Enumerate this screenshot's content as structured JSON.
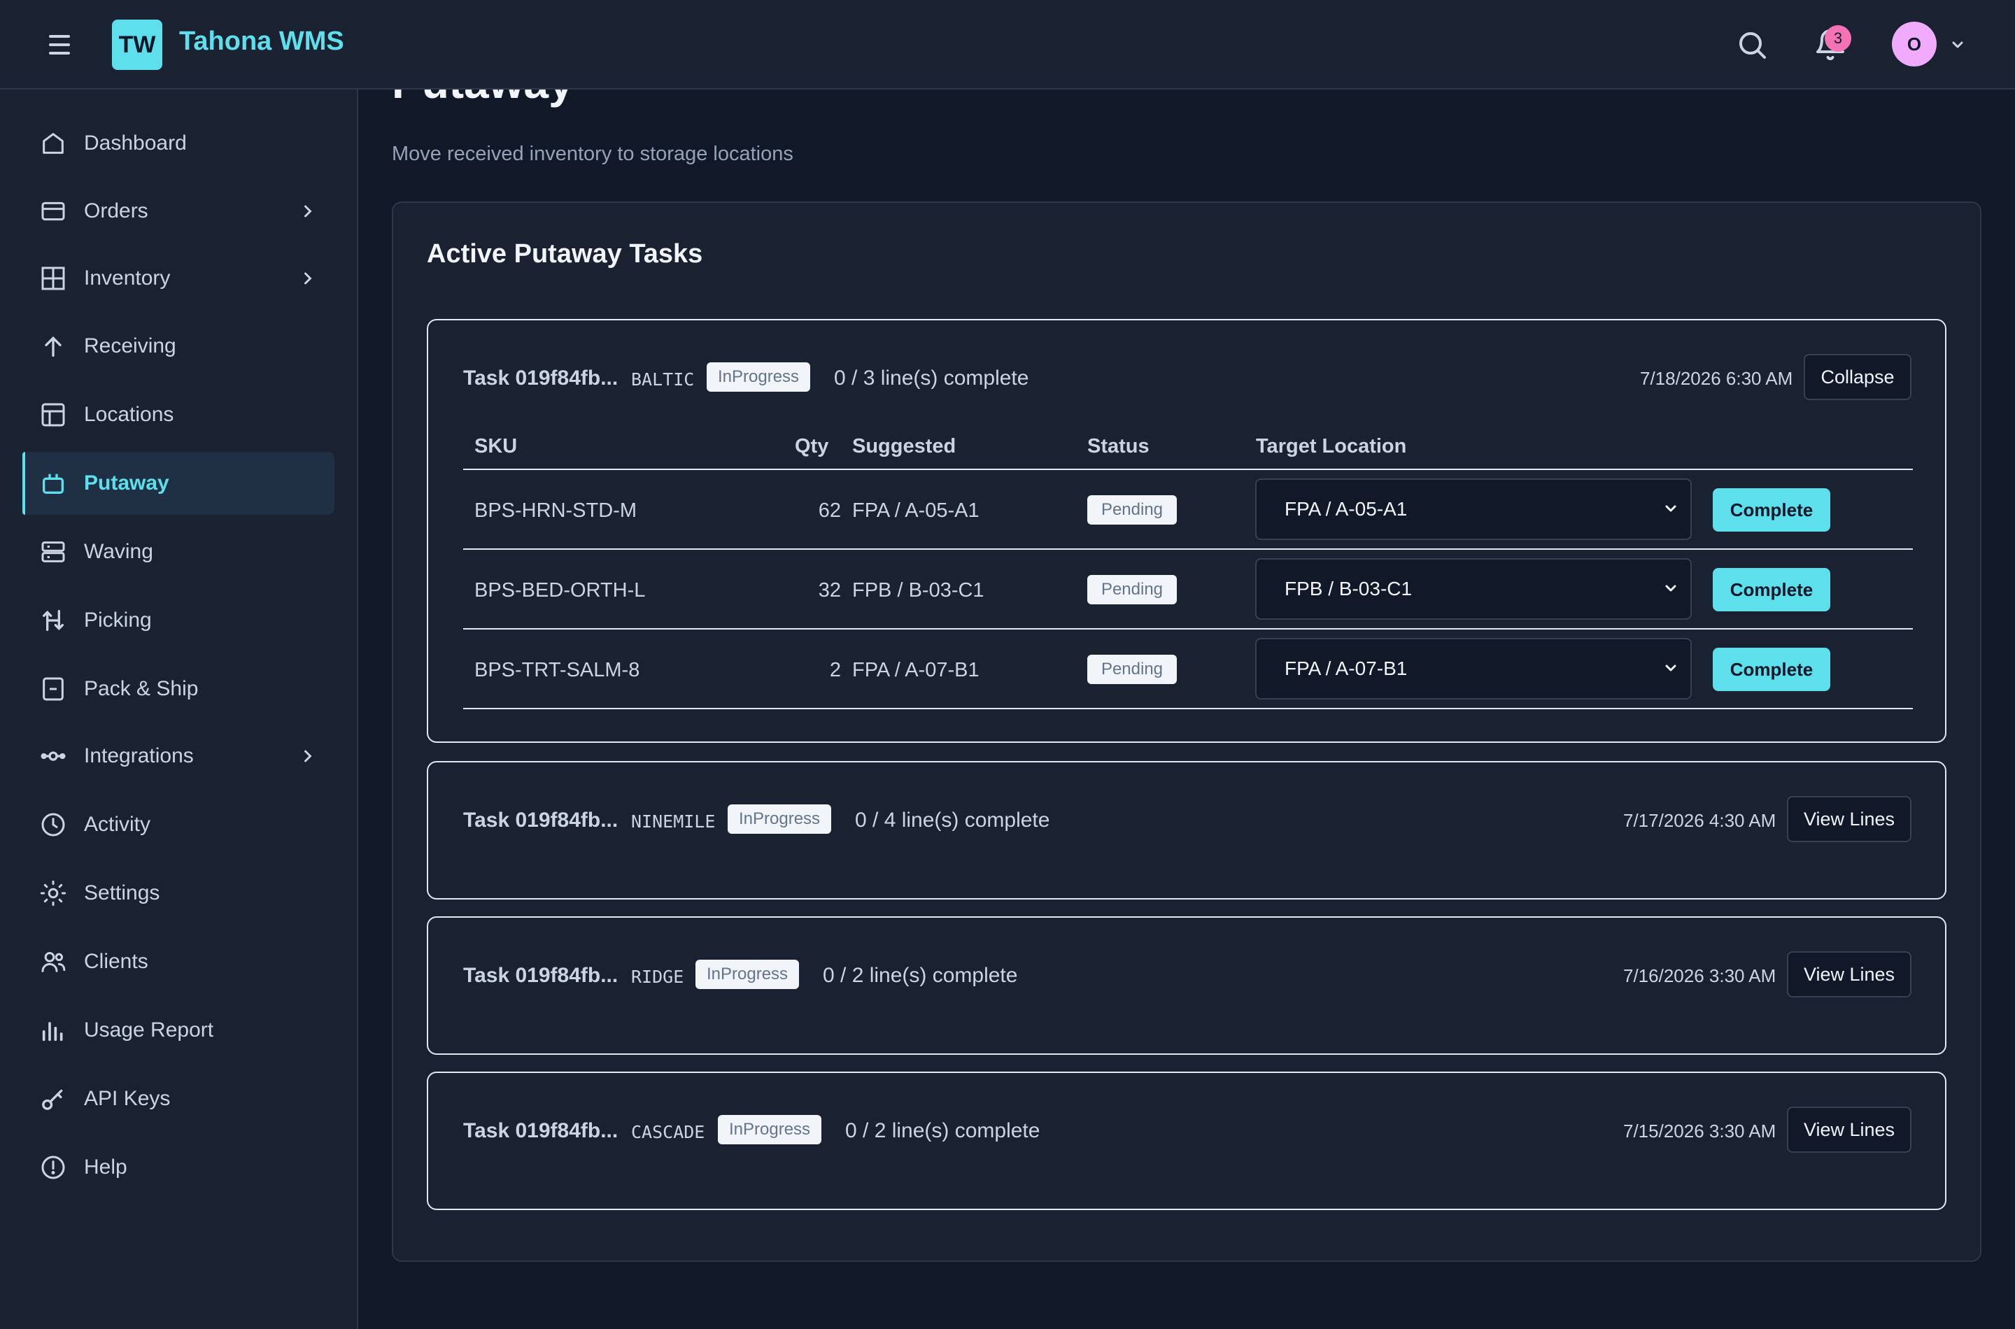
{
  "app": {
    "logo_text": "TW",
    "title": "Tahona WMS",
    "notification_count": "3",
    "avatar_initial": "O",
    "accent_color": "#5ee0ec"
  },
  "sidebar": {
    "items": [
      {
        "label": "Dashboard",
        "icon": "home-icon"
      },
      {
        "label": "Orders",
        "icon": "card-icon",
        "has_submenu": true
      },
      {
        "label": "Inventory",
        "icon": "grid-icon",
        "has_submenu": true
      },
      {
        "label": "Receiving",
        "icon": "arrow-up-icon"
      },
      {
        "label": "Locations",
        "icon": "table-icon"
      },
      {
        "label": "Putaway",
        "icon": "tray-icon",
        "active": true
      },
      {
        "label": "Waving",
        "icon": "server-icon"
      },
      {
        "label": "Picking",
        "icon": "arrows-icon"
      },
      {
        "label": "Pack & Ship",
        "icon": "box-icon"
      },
      {
        "label": "Integrations",
        "icon": "plug-icon",
        "has_submenu": true
      },
      {
        "label": "Activity",
        "icon": "clock-icon"
      },
      {
        "label": "Settings",
        "icon": "sun-gear-icon"
      },
      {
        "label": "Clients",
        "icon": "users-icon"
      },
      {
        "label": "Usage Report",
        "icon": "bar-chart-icon"
      },
      {
        "label": "API Keys",
        "icon": "key-icon"
      },
      {
        "label": "Help",
        "icon": "help-circle-icon"
      }
    ]
  },
  "page": {
    "title": "Putaway",
    "subtitle": "Move received inventory to storage locations",
    "card_title": "Active Putaway Tasks"
  },
  "table_headers": {
    "sku": "SKU",
    "qty": "Qty",
    "suggested": "Suggested",
    "status": "Status",
    "target": "Target Location"
  },
  "tasks": [
    {
      "name": "Task 019f84fb...",
      "client": "BALTIC",
      "status": "InProgress",
      "progress": "0 / 3 line(s) complete",
      "date": "7/18/2026 6:30 AM",
      "action": "Collapse",
      "lines": [
        {
          "sku": "BPS-HRN-STD-M",
          "qty": "62",
          "suggested": "FPA / A-05-A1",
          "status": "Pending",
          "target": "FPA / A-05-A1",
          "action": "Complete"
        },
        {
          "sku": "BPS-BED-ORTH-L",
          "qty": "32",
          "suggested": "FPB / B-03-C1",
          "status": "Pending",
          "target": "FPB / B-03-C1",
          "action": "Complete"
        },
        {
          "sku": "BPS-TRT-SALM-8",
          "qty": "2",
          "suggested": "FPA / A-07-B1",
          "status": "Pending",
          "target": "FPA / A-07-B1",
          "action": "Complete"
        }
      ]
    },
    {
      "name": "Task 019f84fb...",
      "client": "NINEMILE",
      "status": "InProgress",
      "progress": "0 / 4 line(s) complete",
      "date": "7/17/2026 4:30 AM",
      "action": "View Lines"
    },
    {
      "name": "Task 019f84fb...",
      "client": "RIDGE",
      "status": "InProgress",
      "progress": "0 / 2 line(s) complete",
      "date": "7/16/2026 3:30 AM",
      "action": "View Lines"
    },
    {
      "name": "Task 019f84fb...",
      "client": "CASCADE",
      "status": "InProgress",
      "progress": "0 / 2 line(s) complete",
      "date": "7/15/2026 3:30 AM",
      "action": "View Lines"
    }
  ]
}
